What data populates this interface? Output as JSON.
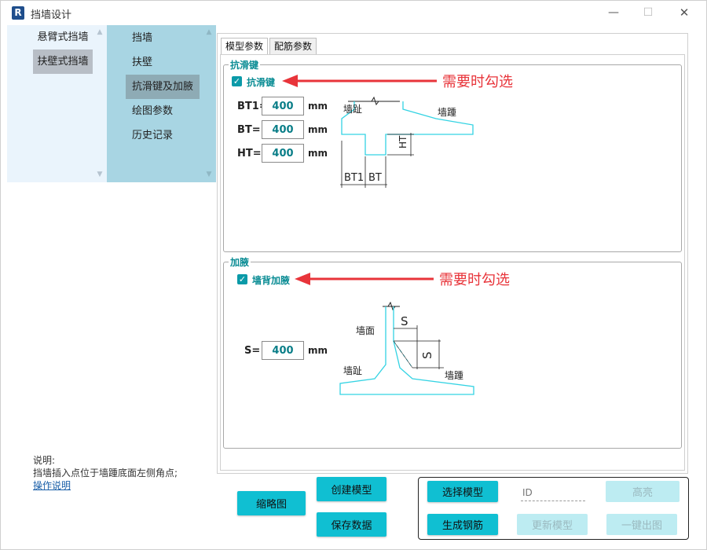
{
  "window": {
    "title": "挡墙设计",
    "logo_text": "R",
    "minimize": "—",
    "maximize": "☐",
    "close": "✕"
  },
  "nav_primary": {
    "items": [
      {
        "label": "悬臂式挡墙"
      },
      {
        "label": "扶壁式挡墙"
      }
    ]
  },
  "nav_secondary": {
    "items": [
      {
        "label": "挡墙"
      },
      {
        "label": "扶壁"
      },
      {
        "label": "抗滑键及加腋"
      },
      {
        "label": "绘图参数"
      },
      {
        "label": "历史记录"
      }
    ]
  },
  "tabs": [
    {
      "label": "模型参数"
    },
    {
      "label": "配筋参数"
    }
  ],
  "shear_key": {
    "group_title": "抗滑键",
    "checkbox_label": "抗滑键",
    "annotation": "需要时勾选",
    "params": [
      {
        "label": "BT1=",
        "value": "400",
        "unit": "mm"
      },
      {
        "label": "BT=",
        "value": "400",
        "unit": "mm"
      },
      {
        "label": "HT=",
        "value": "400",
        "unit": "mm"
      }
    ],
    "diagram": {
      "toe": "墙趾",
      "heel": "墙踵",
      "dim_bt1": "BT1",
      "dim_bt": "BT",
      "dim_ht": "HT"
    }
  },
  "haunch": {
    "group_title": "加腋",
    "checkbox_label": "墙背加腋",
    "annotation": "需要时勾选",
    "param": {
      "label": "S=",
      "value": "400",
      "unit": "mm"
    },
    "diagram": {
      "face": "墙面",
      "toe": "墙趾",
      "heel": "墙踵",
      "dim_s_h": "S",
      "dim_s_v": "S"
    }
  },
  "help": {
    "title": "说明:",
    "text": "挡墙插入点位于墙踵底面左侧角点;",
    "link": "操作说明"
  },
  "buttons": {
    "thumbnail": "缩略图",
    "create_model": "创建模型",
    "save_data": "保存数据",
    "select_model": "选择模型",
    "generate_rebar": "生成钢筋",
    "id_placeholder": "ID",
    "highlight": "高亮",
    "update_model": "更新模型",
    "one_click_output": "一键出图"
  },
  "colors": {
    "accent": "#10bfd2",
    "teal_text": "#0a8c94",
    "annotation_red": "#e8343a",
    "nav_secondary_bg": "#a8d5e3"
  }
}
